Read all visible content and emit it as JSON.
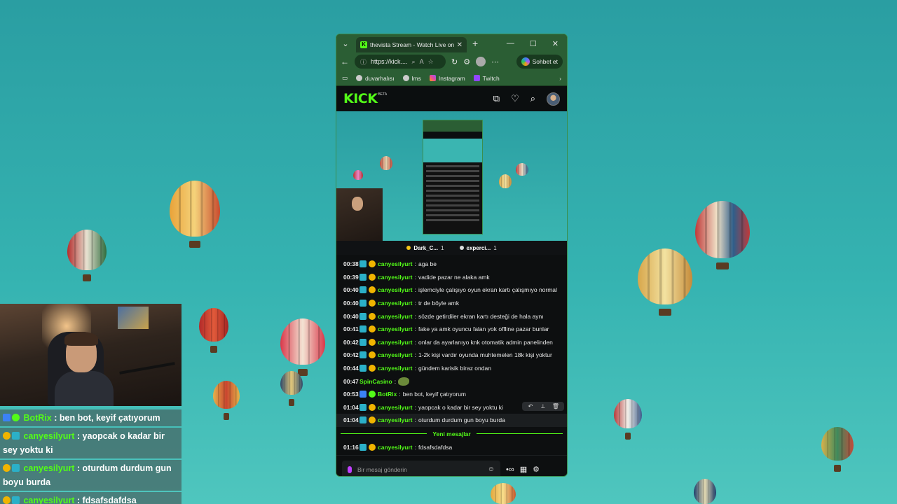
{
  "browser": {
    "tab_title": "thevista Stream - Watch Live on Kick",
    "url": "https://kick....",
    "copilot_label": "Sohbet et",
    "bookmarks": [
      {
        "label": "duvarhalısı",
        "icon": "globe-icon"
      },
      {
        "label": "lms",
        "icon": "globe-icon"
      },
      {
        "label": "Instagram",
        "icon": "instagram-icon"
      },
      {
        "label": "Twitch",
        "icon": "twitch-icon"
      }
    ]
  },
  "kick": {
    "logo": "KICK",
    "beta": "BETA"
  },
  "pins": [
    {
      "name": "Dark_C...",
      "count": "1"
    },
    {
      "name": "experci...",
      "count": "1"
    }
  ],
  "chat": {
    "messages": [
      {
        "time": "00:38",
        "user": "canyesilyurt",
        "text": "aga be"
      },
      {
        "time": "00:39",
        "user": "canyesilyurt",
        "text": "vadide pazar ne alaka amk"
      },
      {
        "time": "00:40",
        "user": "canyesilyurt",
        "text": "işlemciyle çalışıyo oyun ekran kartı çalışmıyo normal"
      },
      {
        "time": "00:40",
        "user": "canyesilyurt",
        "text": "tr de böyle amk"
      },
      {
        "time": "00:40",
        "user": "canyesilyurt",
        "text": "sözde getirdiler ekran kartı desteği de hala aynı"
      },
      {
        "time": "00:41",
        "user": "canyesilyurt",
        "text": "fake ya amk oyuncu falan yok offline pazar bunlar"
      },
      {
        "time": "00:42",
        "user": "canyesilyurt",
        "text": "onlar da ayarlanıyo knk otomatik admin panelinden"
      },
      {
        "time": "00:42",
        "user": "canyesilyurt",
        "text": "1-2k kişi vardır oyunda muhtemelen 18k kişi yoktur"
      },
      {
        "time": "00:44",
        "user": "canyesilyurt",
        "text": "gündem karisik biraz ondan"
      }
    ],
    "spin": {
      "time": "00:47",
      "user": "SpinCasino"
    },
    "bot": {
      "time": "00:53",
      "user": "BotRix",
      "text": "ben bot, keyif çatıyorum"
    },
    "after": [
      {
        "time": "01:04",
        "user": "canyesilyurt",
        "text": "yaopcak o kadar bir sey yoktu ki"
      },
      {
        "time": "01:04",
        "user": "canyesilyurt",
        "text": "oturdum durdum gun boyu burda"
      }
    ],
    "new_messages_label": "Yeni mesajlar",
    "latest": {
      "time": "01:16",
      "user": "canyesilyurt",
      "text": "fdsafsdafdsa"
    },
    "input_placeholder": "Bir mesaj gönderin"
  },
  "overlay": [
    {
      "user": "BotRix",
      "text": " : ben bot, keyif çatıyorum",
      "badge_color": "#3b82f6"
    },
    {
      "user": "canyesilyurt",
      "text": " : yaopcak o kadar bir sey yoktu ki",
      "badge_color": "#f0b400"
    },
    {
      "user": "canyesilyurt",
      "text": " : oturdum durdum gun boyu burda",
      "badge_color": "#f0b400"
    },
    {
      "user": "canyesilyurt",
      "text": " : fdsafsdafdsa",
      "badge_color": "#f0b400"
    }
  ],
  "colors": {
    "accent": "#53fc18",
    "sky": "#35b3b1",
    "browser_frame": "#2b5e34"
  }
}
